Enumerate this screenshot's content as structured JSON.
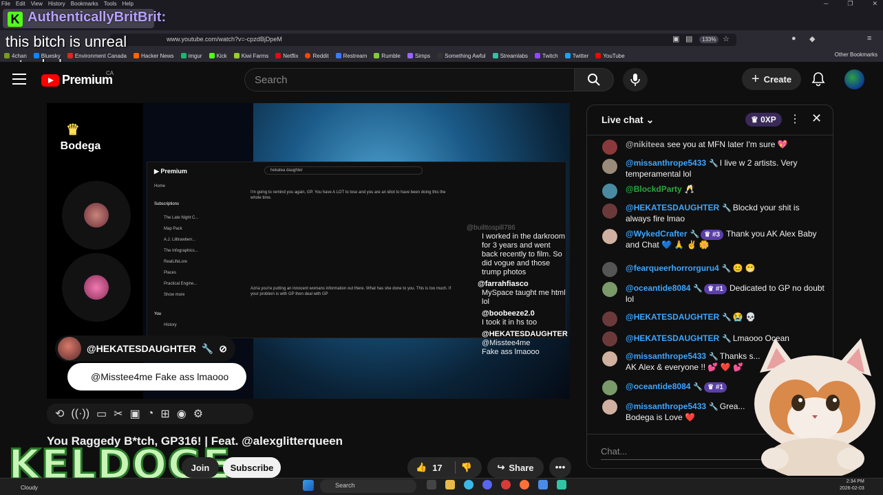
{
  "browser": {
    "menu": [
      "File",
      "Edit",
      "View",
      "History",
      "Bookmarks",
      "Tools",
      "Help"
    ],
    "url": "www.youtube.com/watch?v=-cpzdBjDpeM",
    "zoom": "133%",
    "bookmarks": [
      "4chan",
      "Bluesky",
      "Environment Canada",
      "Hacker News",
      "imgur",
      "Kick",
      "Kiwi Farms",
      "Netflix",
      "Reddit",
      "Restream",
      "Rumble",
      "Simps",
      "Something Awful",
      "Streamlabs",
      "Twitch",
      "Twitter",
      "YouTube"
    ],
    "other_bookmarks": "Other Bookmarks"
  },
  "overlay": {
    "chat_user": "AuthenticallyBritBrit:",
    "chat_message": "this bitch is unreal retarded",
    "brand": "KELDOGE"
  },
  "youtube": {
    "logo": "Premium",
    "region": "CA",
    "search_placeholder": "Search",
    "create_label": "Create"
  },
  "video": {
    "bodega_logo": "Bodega",
    "badge_user": "@HEKATESDAUGHTER",
    "badge_message": "@Misstee4me Fake ass lmaooo",
    "inner": {
      "search": "hekatea daughter",
      "nav": [
        "Home",
        "Subscriptions",
        "The Late Night C...",
        "Map Pack",
        "A.J. Lilltrawberr...",
        "The Infographics...",
        "RealLifeLore",
        "Places",
        "Practical Engine...",
        "Show more",
        "You",
        "History"
      ],
      "comment1": "I'm going to remind you again, GP. You have A LOT to lose and you are an idiot to have been doing this the whole time.",
      "comment2": "Azria you're putting an innocent womans information out there. What has she done to you. This is too much. If your problem is with GP then deal with GP",
      "chat": [
        {
          "user": "@builttospill786",
          "text": "I worked in the darkroom for 3 years and went back recently to film. So did vogue and those trump photos"
        },
        {
          "user": "@farrahfiasco",
          "text": "MySpace taught me html lol"
        },
        {
          "user": "@boobeeze2.0",
          "text": "I took it in hs too"
        },
        {
          "user": "@HEKATESDAUGHTER",
          "text": "@Misstee4me Fake ass lmaooo"
        }
      ]
    },
    "title": "You Raggedy B*tch, GP316! | Feat. @alexglitterqueen",
    "join": "Join",
    "subscribe": "Subscribe",
    "likes": "17",
    "share": "Share"
  },
  "chat": {
    "title": "Live chat",
    "xp": "0XP",
    "input_placeholder": "Chat...",
    "messages": [
      {
        "author": "@nikiteea",
        "badge": "",
        "text": "see you at MFN later I'm sure 💖",
        "color": "#aaaaaa"
      },
      {
        "author": "@missanthrope5433",
        "badge": "",
        "text": "I live w 2 artists. Very temperamental lol",
        "color": "#3ea6ff"
      },
      {
        "author": "@BlockdParty",
        "badge": "",
        "text": "🥂",
        "color": "#2ba640"
      },
      {
        "author": "@HEKATESDAUGHTER",
        "badge": "",
        "text": "Blockd your shit is always fire lmao",
        "color": "#3ea6ff"
      },
      {
        "author": "@WykedCrafter",
        "badge": "#3",
        "text": "Thank you AK Alex Baby and Chat 💙 🙏 ✌️ 🌼",
        "color": "#3ea6ff"
      },
      {
        "author": "@fearqueerhorrorguru4",
        "badge": "",
        "text": "😊 😁",
        "color": "#3ea6ff"
      },
      {
        "author": "@oceantide8084",
        "badge": "#1",
        "text": "Dedicated to GP no doubt lol",
        "color": "#3ea6ff"
      },
      {
        "author": "@HEKATESDAUGHTER",
        "badge": "",
        "text": "😭 💀",
        "color": "#3ea6ff"
      },
      {
        "author": "@HEKATESDAUGHTER",
        "badge": "",
        "text": "Lmaooo Ocean",
        "color": "#3ea6ff"
      },
      {
        "author": "@missanthrope5433",
        "badge": "",
        "text": "Thanks s... AK Alex & everyone !! 💕 ❤️ 💕",
        "color": "#3ea6ff"
      },
      {
        "author": "@oceantide8084",
        "badge": "#1",
        "text": "",
        "color": "#3ea6ff"
      },
      {
        "author": "@missanthrope5433",
        "badge": "",
        "text": "Grea... Bodega is Love ❤️",
        "color": "#3ea6ff"
      }
    ]
  },
  "taskbar": {
    "weather": "Cloudy",
    "search": "Search",
    "time": "2:34 PM",
    "date": "2026-02-03"
  }
}
